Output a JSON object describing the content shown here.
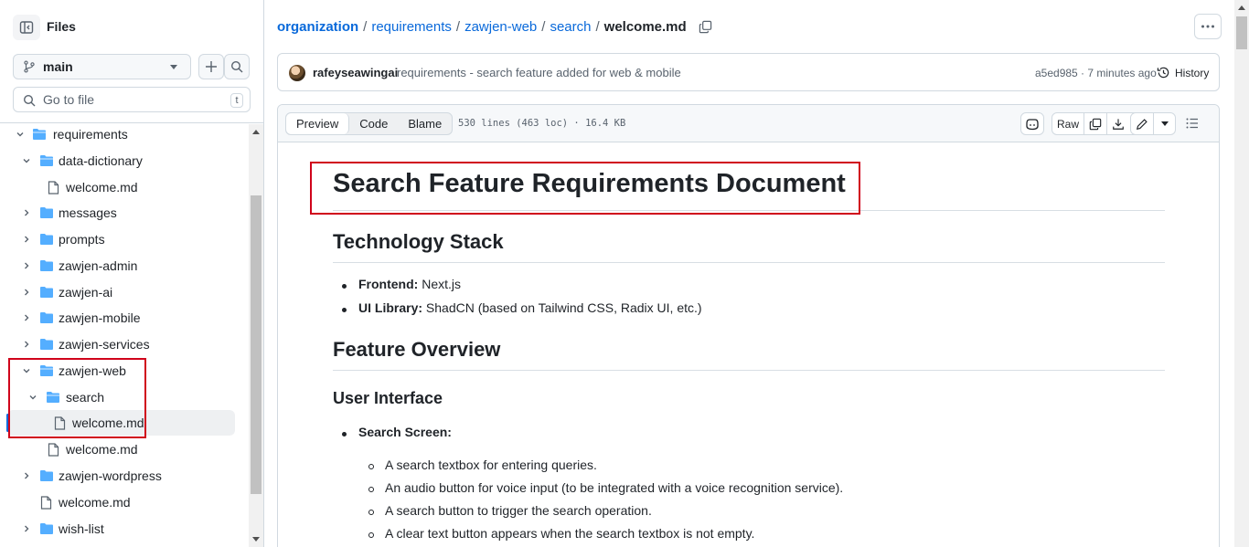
{
  "sidebar": {
    "title": "Files",
    "branch": "main",
    "goto_placeholder": "Go to file",
    "goto_shortcut": "t",
    "tree": [
      {
        "label": "requirements",
        "type": "folder",
        "open": true
      },
      {
        "label": "data-dictionary",
        "type": "folder",
        "open": true
      },
      {
        "label": "welcome.md",
        "type": "file"
      },
      {
        "label": "messages",
        "type": "folder",
        "open": false
      },
      {
        "label": "prompts",
        "type": "folder",
        "open": false
      },
      {
        "label": "zawjen-admin",
        "type": "folder",
        "open": false
      },
      {
        "label": "zawjen-ai",
        "type": "folder",
        "open": false
      },
      {
        "label": "zawjen-mobile",
        "type": "folder",
        "open": false
      },
      {
        "label": "zawjen-services",
        "type": "folder",
        "open": false
      },
      {
        "label": "zawjen-web",
        "type": "folder",
        "open": true
      },
      {
        "label": "search",
        "type": "folder",
        "open": true
      },
      {
        "label": "welcome.md",
        "type": "file",
        "active": true
      },
      {
        "label": "welcome.md",
        "type": "file"
      },
      {
        "label": "zawjen-wordpress",
        "type": "folder",
        "open": false
      },
      {
        "label": "welcome.md",
        "type": "file"
      },
      {
        "label": "wish-list",
        "type": "folder",
        "open": false
      }
    ]
  },
  "breadcrumb": {
    "items": [
      "organization",
      "requirements",
      "zawjen-web",
      "search"
    ],
    "current": "welcome.md",
    "separator": "/"
  },
  "commit": {
    "author": "rafeyseawingai",
    "message": "requirements - search feature added for web & mobile",
    "meta": "a5ed985 · 7 minutes ago",
    "history_label": "History"
  },
  "file": {
    "tabs": [
      "Preview",
      "Code",
      "Blame"
    ],
    "active_tab": "Preview",
    "info": "530 lines (463 loc) · 16.4 KB",
    "raw_label": "Raw"
  },
  "document": {
    "h1": "Search Feature Requirements Document",
    "tech_heading": "Technology Stack",
    "tech_items": [
      {
        "key": "Frontend:",
        "value": " Next.js"
      },
      {
        "key": "UI Library:",
        "value": " ShadCN (based on Tailwind CSS, Radix UI, etc.)"
      }
    ],
    "overview_heading": "Feature Overview",
    "ui_heading": "User Interface",
    "screen_item": "Search Screen:",
    "screen_subitems": [
      "A search textbox for entering queries.",
      "An audio button for voice input (to be integrated with a voice recognition service).",
      "A search button to trigger the search operation.",
      "A clear text button appears when the search textbox is not empty."
    ]
  },
  "colors": {
    "link": "#0969da",
    "folder": "#54aeff",
    "highlight": "#d0021b"
  }
}
